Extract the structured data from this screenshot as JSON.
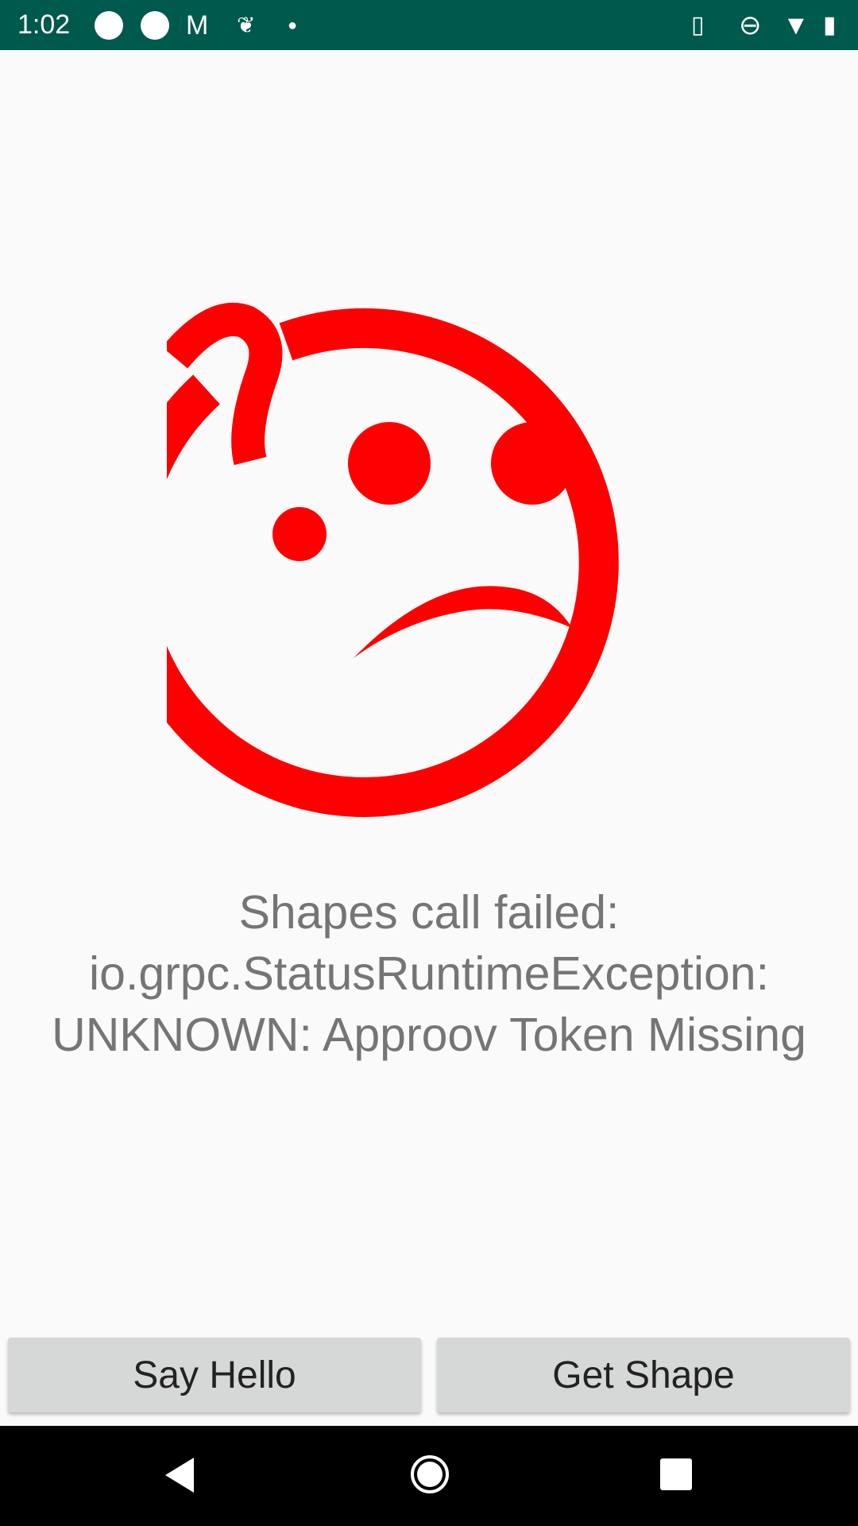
{
  "status_bar": {
    "time": "1:02"
  },
  "message": {
    "line1": "Shapes call failed:",
    "line2": "io.grpc.StatusRuntimeException:",
    "line3": "UNKNOWN: Approov Token Missing"
  },
  "buttons": {
    "say_hello": "Say Hello",
    "get_shape": "Get Shape"
  },
  "colors": {
    "status_bar": "#00594d",
    "face": "#ff0000",
    "text": "#757575",
    "button": "#d6d7d7"
  }
}
